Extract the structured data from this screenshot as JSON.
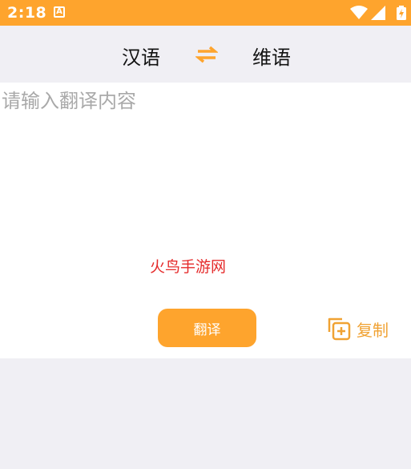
{
  "status_bar": {
    "time": "2:18",
    "app_icon_letter": "A",
    "icons": [
      "wifi-icon",
      "signal-icon",
      "battery-charging-icon"
    ]
  },
  "languages": {
    "source": "汉语",
    "target": "维语",
    "swap_icon": "swap-arrows-icon"
  },
  "input": {
    "placeholder": "请输入翻译内容",
    "value": ""
  },
  "watermark": "火鸟手游网",
  "actions": {
    "translate_label": "翻译",
    "copy_label": "复制",
    "copy_icon": "copy-add-icon"
  },
  "colors": {
    "accent": "#fea42d",
    "background": "#f0eff4",
    "panel": "#ffffff",
    "placeholder": "#a9a9a9",
    "watermark": "#e52b2b"
  }
}
